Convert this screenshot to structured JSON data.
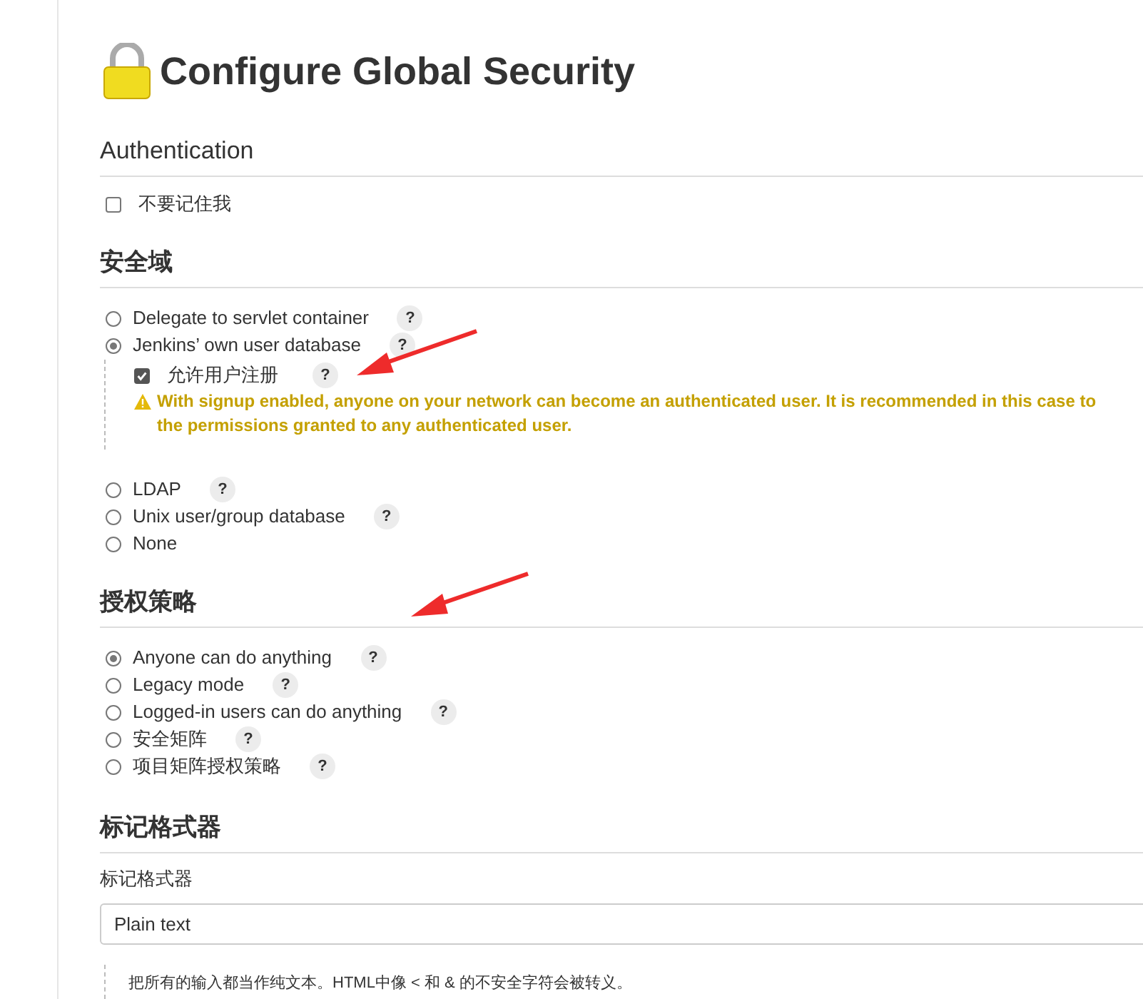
{
  "title": "Configure Global Security",
  "authentication": {
    "heading": "Authentication",
    "remember_me": {
      "label": "不要记住我",
      "checked": false
    }
  },
  "security_realm": {
    "heading": "安全域",
    "options": [
      {
        "label": "Delegate to servlet container",
        "selected": false,
        "help": "?"
      },
      {
        "label": "Jenkins’ own user database",
        "selected": true,
        "help": "?",
        "signup": {
          "label": "允许用户注册",
          "checked": true,
          "help": "?",
          "warning": "With signup enabled, anyone on your network can become an authenticated user. It is recommended in this case to",
          "warning_cont": "the permissions granted to any authenticated user."
        }
      },
      {
        "label": "LDAP",
        "selected": false,
        "help": "?"
      },
      {
        "label": "Unix user/group database",
        "selected": false,
        "help": "?"
      },
      {
        "label": "None",
        "selected": false
      }
    ]
  },
  "authorization": {
    "heading": "授权策略",
    "options": [
      {
        "label": "Anyone can do anything",
        "selected": true,
        "help": "?"
      },
      {
        "label": "Legacy mode",
        "selected": false,
        "help": "?"
      },
      {
        "label": "Logged-in users can do anything",
        "selected": false,
        "help": "?"
      },
      {
        "label": "安全矩阵",
        "selected": false,
        "help": "?"
      },
      {
        "label": "项目矩阵授权策略",
        "selected": false,
        "help": "?"
      }
    ]
  },
  "markup_formatter": {
    "heading": "标记格式器",
    "label": "标记格式器",
    "value": "Plain text",
    "description": "把所有的输入都当作纯文本。HTML中像 < 和 & 的不安全字符会被转义。"
  }
}
